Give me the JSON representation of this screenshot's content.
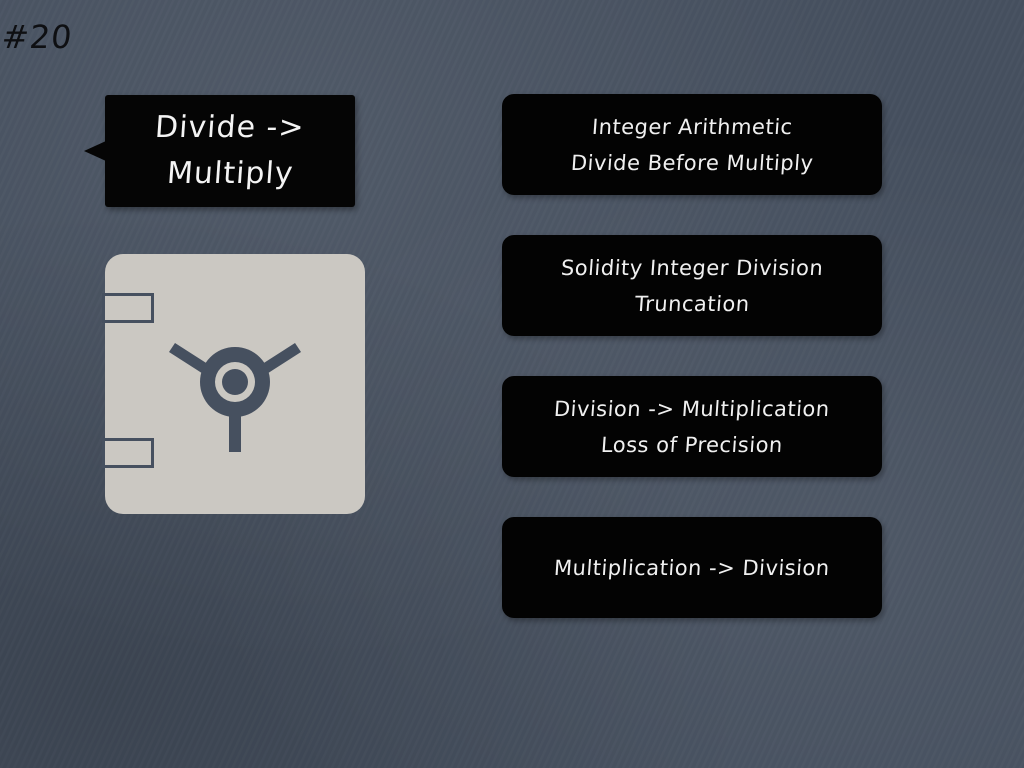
{
  "slide": {
    "number": "#20"
  },
  "callout": {
    "line1": "Divide ->",
    "line2": "Multiply"
  },
  "icon": {
    "name": "safe-vault-icon",
    "color": "#cbc8c2"
  },
  "cards": [
    {
      "line1": "Integer Arithmetic",
      "line2": "Divide Before Multiply"
    },
    {
      "line1": "Solidity Integer Division",
      "line2": "Truncation"
    },
    {
      "line1": "Division -> Multiplication",
      "line2": "Loss of Precision"
    },
    {
      "line1": "Multiplication -> Division"
    }
  ],
  "colors": {
    "background": "#46505f",
    "card": "#030303",
    "text": "#f0f0f0",
    "slide_number": "#0e0f12"
  }
}
